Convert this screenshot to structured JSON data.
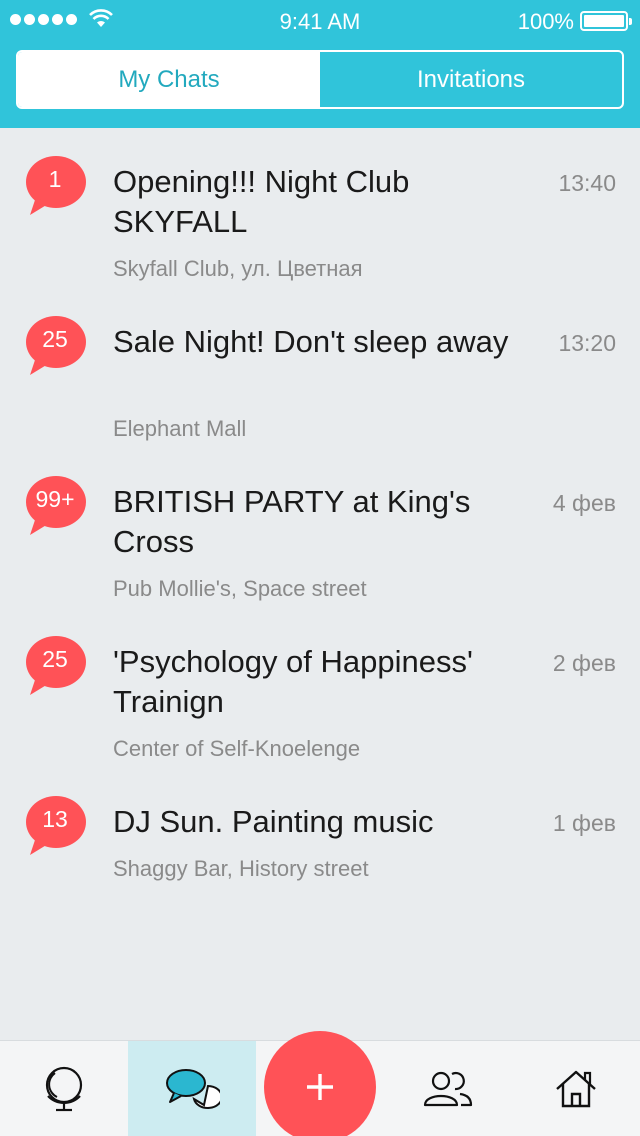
{
  "status_bar": {
    "time": "9:41 AM",
    "battery": "100%"
  },
  "tabs": {
    "my_chats": "My Chats",
    "invitations": "Invitations"
  },
  "chats": [
    {
      "count": "1",
      "title": "Opening!!! Night Club SKYFALL",
      "time": "13:40",
      "place": "Skyfall Club, ул. Цветная"
    },
    {
      "count": "25",
      "title": "Sale Night! Don't sleep away",
      "time": "13:20",
      "place": "Elephant Mall"
    },
    {
      "count": "99+",
      "title": "BRITISH PARTY at King's Cross",
      "time": "4 фев",
      "place": "Pub Mollie's, Space street"
    },
    {
      "count": "25",
      "title": "'Psychology of Happiness' Trainign",
      "time": "2 фев",
      "place": "Center of Self-Knoelenge"
    },
    {
      "count": "13",
      "title": "DJ Sun. Painting music",
      "time": "1 фев",
      "place": "Shaggy Bar, History street"
    }
  ],
  "colors": {
    "header": "#30c4da",
    "badge": "#ff5257",
    "background": "#e9ecee",
    "accent_text": "#22a9be"
  },
  "tabbar_icons": [
    "globe-icon",
    "chat-bubbles-icon",
    "plus-icon",
    "people-icon",
    "home-icon"
  ]
}
